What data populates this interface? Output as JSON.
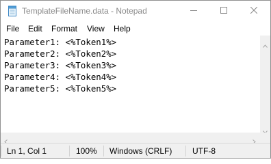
{
  "window": {
    "title": "TemplateFileName.data - Notepad",
    "icon": "notepad-icon",
    "controls": [
      "minimize-icon",
      "maximize-icon",
      "close-icon"
    ]
  },
  "menu": {
    "file": "File",
    "edit": "Edit",
    "format": "Format",
    "view": "View",
    "help": "Help"
  },
  "editor": {
    "lines": [
      "Parameter1: <%Token1%>",
      "Parameter2: <%Token2%>",
      "Parameter3: <%Token3%>",
      "Parameter4: <%Token4%>",
      "Parameter5: <%Token5%>"
    ]
  },
  "status": {
    "position": "Ln 1, Col 1",
    "zoom": "100%",
    "line_endings": "Windows (CRLF)",
    "encoding": "UTF-8"
  }
}
